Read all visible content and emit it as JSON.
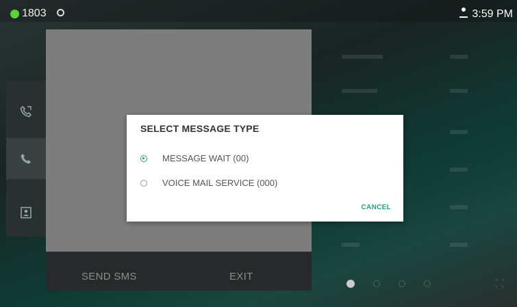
{
  "status_bar": {
    "extension": "1803",
    "time": "3:59 PM",
    "accent_color": "#5ad03a"
  },
  "side_rail": {
    "items": [
      {
        "icon": "call-history-icon"
      },
      {
        "icon": "phone-icon"
      },
      {
        "icon": "contacts-icon"
      }
    ]
  },
  "bottom_bar": {
    "send_sms_label": "SEND SMS",
    "exit_label": "EXIT"
  },
  "dialog": {
    "title": "SELECT MESSAGE TYPE",
    "options": [
      {
        "label": "MESSAGE WAIT (00)",
        "selected": true
      },
      {
        "label": "VOICE MAIL SERVICE (000)",
        "selected": false
      }
    ],
    "cancel_label": "CANCEL",
    "accent_color": "#2e9f76"
  }
}
